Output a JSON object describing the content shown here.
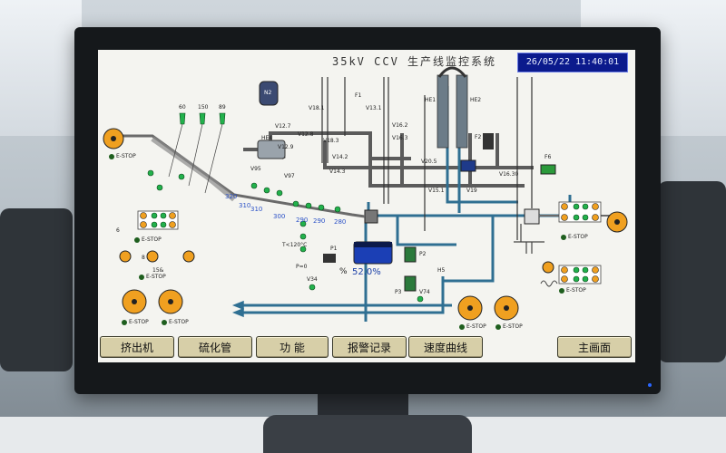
{
  "system": {
    "title": "35kV CCV 生产线监控系统",
    "datetime": "26/05/22 11:40:01",
    "level_percent": "52.0%",
    "percent_sign": "%"
  },
  "labels": {
    "n2": "N2",
    "g60": "60",
    "g150": "150",
    "g89": "89",
    "he1": "HE1",
    "he2": "HE2",
    "he4": "HE4",
    "f1": "F1",
    "f2": "F2",
    "f6": "F6",
    "p1": "P1",
    "p2": "P2",
    "p3": "P3",
    "h5": "H5",
    "v12_7": "V12.7",
    "v12_8": "V12.8",
    "v12_9": "V12.9",
    "v18_1": "V18.1",
    "v13_1": "V13.1",
    "v97": "V97",
    "v95": "V95",
    "v14_2": "V14.2",
    "v14_3": "V14.3",
    "v18_3": "V18.3",
    "v20_5": "V20.5",
    "v15_1": "V15.1",
    "v19": "V19",
    "v16_2": "V16.2",
    "v16_3": "V16.3",
    "v16_30": "V16.30",
    "v34": "V34",
    "v74": "V74",
    "v34b": "V34",
    "p0": "P=0",
    "t120": "T<120°C",
    "t320": "320",
    "t310a": "310",
    "t310b": "310",
    "t300": "300",
    "t290a": "290",
    "t290b": "290",
    "t280": "280",
    "s15": "15&",
    "s6": "6",
    "s8": "8"
  },
  "estops": [
    "E-STOP",
    "E-STOP",
    "E-STOP",
    "E-STOP",
    "E-STOP",
    "E-STOP",
    "E-STOP",
    "E-STOP",
    "E-STOP"
  ],
  "nav": {
    "extruder": "挤出机",
    "vulcanizing_tube": "硫化管",
    "function": "功 能",
    "alarm_log": "报警记录",
    "speed_curve": "速度曲线",
    "main_screen": "主画面"
  },
  "colors": {
    "pipe_blue": "#2f6f92",
    "pipe_gray": "#5b5b5b",
    "drum_orange": "#f0a020",
    "indicator_green": "#22b14c",
    "clock_bg": "#0b1a8c",
    "button_bg": "#d7cfa8"
  }
}
